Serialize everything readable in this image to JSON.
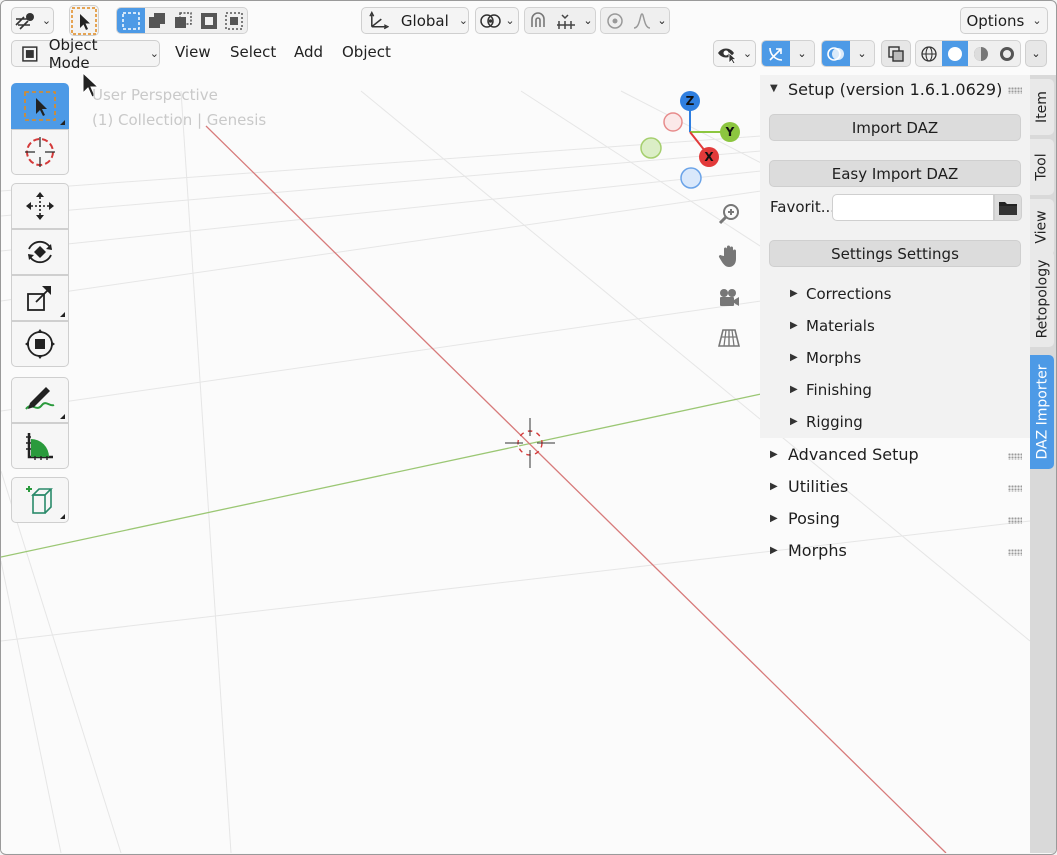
{
  "header": {
    "options_label": "Options",
    "orientation_label": "Global",
    "mode_label": "Object Mode",
    "menus": [
      "View",
      "Select",
      "Add",
      "Object"
    ]
  },
  "viewport": {
    "overlay_line1": "User Perspective",
    "overlay_line2": "(1) Collection | Genesis",
    "gizmo": {
      "z": "Z",
      "y": "Y",
      "x": "X"
    }
  },
  "panel": {
    "setup_title": "Setup (version 1.6.1.0629)",
    "import_daz": "Import DAZ",
    "easy_import_daz": "Easy Import DAZ",
    "favorite_label": "Favorit...",
    "favorite_value": "",
    "settings_button": "Settings Settings",
    "sub_sections": [
      "Corrections",
      "Materials",
      "Morphs",
      "Finishing",
      "Rigging"
    ],
    "sections": [
      "Advanced Setup",
      "Utilities",
      "Posing",
      "Morphs"
    ]
  },
  "tabs": [
    "Item",
    "Tool",
    "View",
    "Retopology",
    "DAZ Importer"
  ],
  "colors": {
    "accent": "#4d9ae6",
    "x_axis": "#e23a3a",
    "y_axis": "#8cc63f",
    "z_axis": "#2f7fe0"
  }
}
